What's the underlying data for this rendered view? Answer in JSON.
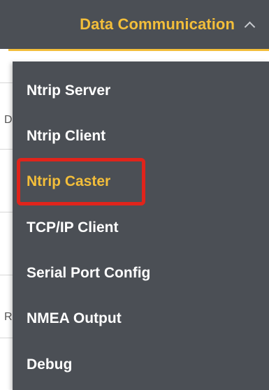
{
  "header": {
    "label": "Data Communication",
    "chevron_icon": "chevron-up-icon"
  },
  "menu": {
    "items": [
      {
        "label": "Ntrip Server",
        "active": false
      },
      {
        "label": "Ntrip Client",
        "active": false
      },
      {
        "label": "Ntrip Caster",
        "active": true
      },
      {
        "label": "TCP/IP Client",
        "active": false
      },
      {
        "label": "Serial Port Config",
        "active": false
      },
      {
        "label": "NMEA Output",
        "active": false
      },
      {
        "label": "Debug",
        "active": false
      }
    ]
  },
  "background": {
    "partial_chars": [
      "D",
      "R"
    ]
  },
  "colors": {
    "header_bg": "#4b4f55",
    "accent": "#f3be3a",
    "menu_bg": "#4b4f55",
    "menu_text": "#ffffff",
    "highlight": "#e0241b"
  }
}
